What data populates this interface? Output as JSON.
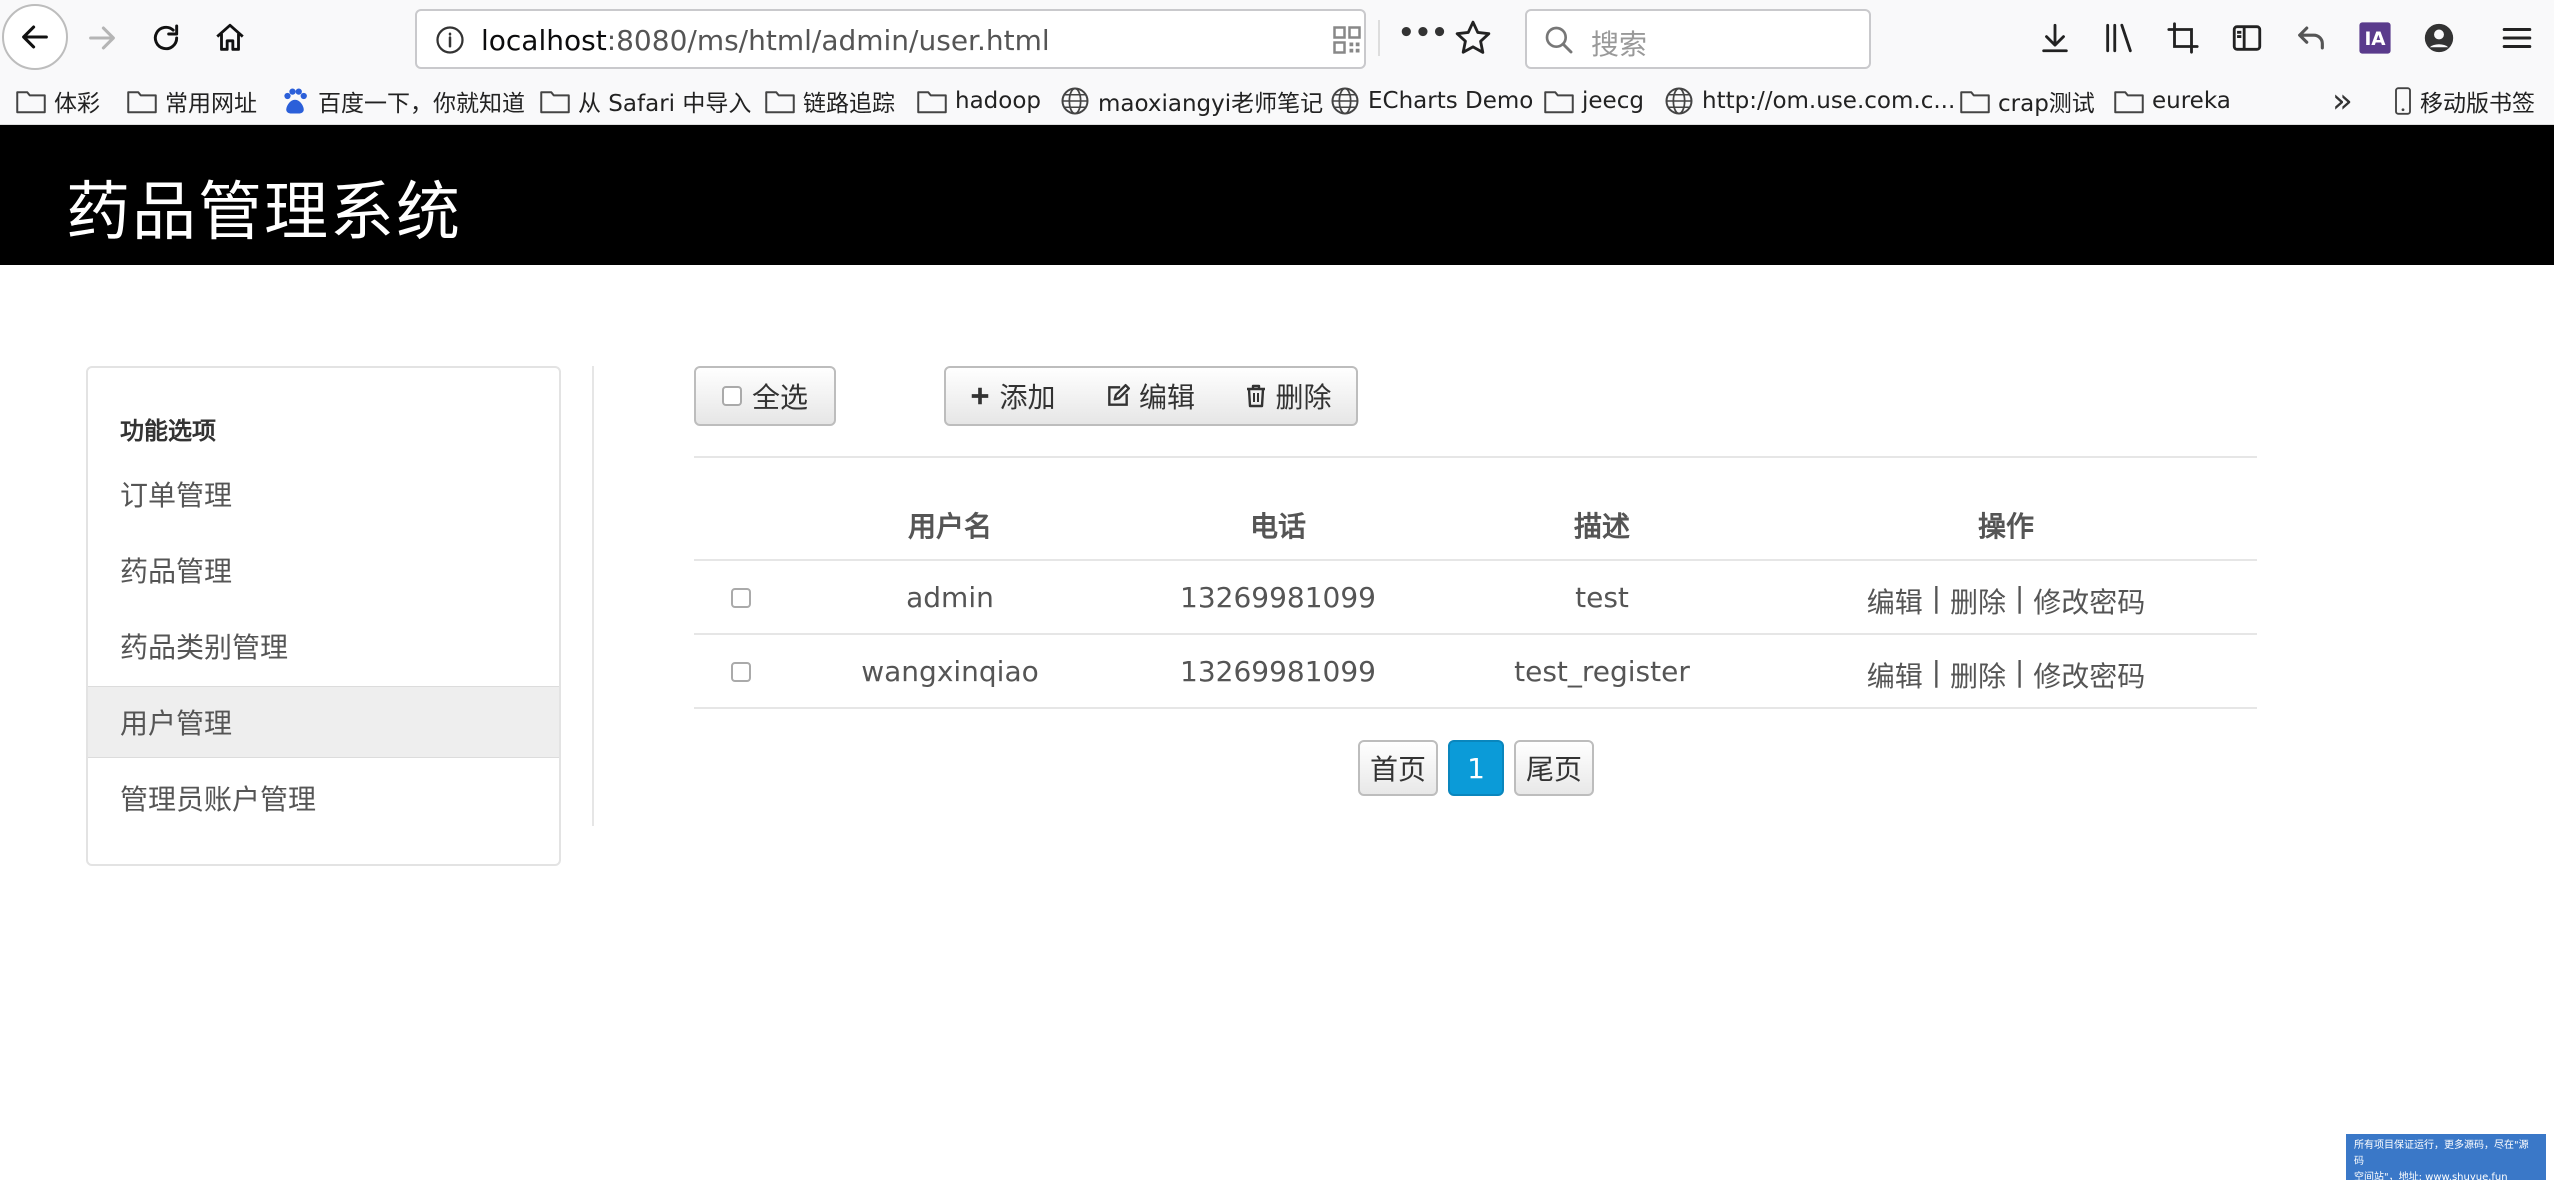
{
  "browser": {
    "url_host": "localhost",
    "url_rest": ":8080/ms/html/admin/user.html",
    "search_placeholder": "搜索",
    "more_icon": "•••",
    "bookmarks": [
      {
        "label": "体彩",
        "icon": "folder-icon"
      },
      {
        "label": "常用网址",
        "icon": "folder-icon"
      },
      {
        "label": "百度一下，你就知道",
        "icon": "baidu-icon"
      },
      {
        "label": "从 Safari 中导入",
        "icon": "folder-icon"
      },
      {
        "label": "链路追踪",
        "icon": "folder-icon"
      },
      {
        "label": "hadoop",
        "icon": "folder-icon"
      },
      {
        "label": "maoxiangyi老师笔记",
        "icon": "globe-icon"
      },
      {
        "label": "ECharts Demo",
        "icon": "globe-icon"
      },
      {
        "label": "jeecg",
        "icon": "folder-icon"
      },
      {
        "label": "http://om.use.com.c...",
        "icon": "globe-icon"
      },
      {
        "label": "crap测试",
        "icon": "folder-icon"
      },
      {
        "label": "eureka",
        "icon": "folder-icon"
      }
    ],
    "overflow": "»",
    "mobile_bookmarks": "移动版书签"
  },
  "app": {
    "title": "药品管理系统"
  },
  "sidebar": {
    "heading": "功能选项",
    "items": [
      {
        "label": "订单管理"
      },
      {
        "label": "药品管理"
      },
      {
        "label": "药品类别管理"
      },
      {
        "label": "用户管理"
      },
      {
        "label": "管理员账户管理"
      }
    ]
  },
  "toolbar": {
    "select_all": "全选",
    "add": "添加",
    "edit": "编辑",
    "delete": "删除"
  },
  "table": {
    "headers": [
      "用户名",
      "电话",
      "描述",
      "操作"
    ],
    "rows": [
      {
        "username": "admin",
        "phone": "13269981099",
        "desc": "test"
      },
      {
        "username": "wangxinqiao",
        "phone": "13269981099",
        "desc": "test_register"
      }
    ],
    "actions": {
      "edit": "编辑",
      "sep": " | ",
      "delete": "删除",
      "change_password": "修改密码"
    }
  },
  "pagination": {
    "first": "首页",
    "current": "1",
    "last": "尾页"
  },
  "watermark": {
    "line1": "所有项目保证运行，更多源码，尽在\"源码",
    "line2": "空间站\"，地址: www.shuyue.fun"
  },
  "colors": {
    "header_bg": "#000000",
    "active_page": "#0b9bd8"
  }
}
